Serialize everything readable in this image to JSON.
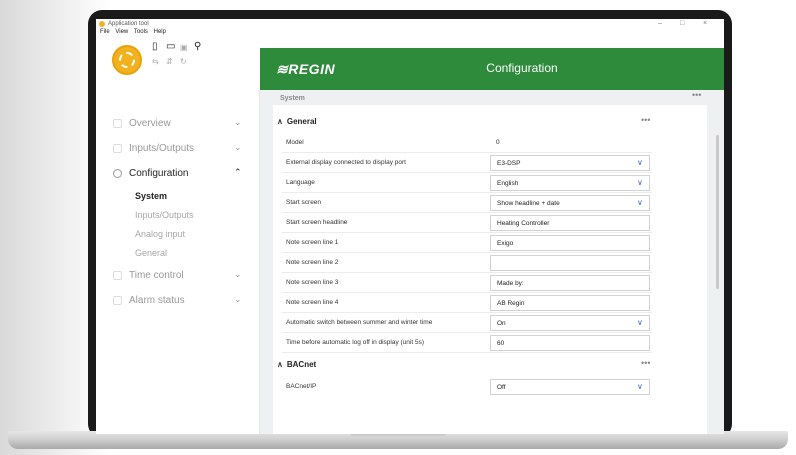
{
  "window": {
    "title": "Application tool",
    "controls": [
      "–",
      "□",
      "×"
    ]
  },
  "menu": [
    "File",
    "View",
    "Tools",
    "Help"
  ],
  "brand": {
    "logo_text": "≋REGIN",
    "accent_color": "#2e8b3b"
  },
  "header": {
    "title": "Configuration"
  },
  "sidebar": {
    "items": [
      {
        "label": "Overview",
        "chevron": "⌄"
      },
      {
        "label": "Inputs/Outputs",
        "chevron": "⌄"
      },
      {
        "label": "Configuration",
        "chevron": "⌃"
      },
      {
        "label": "Time control",
        "chevron": "⌄"
      },
      {
        "label": "Alarm status",
        "chevron": "⌄"
      }
    ],
    "subitems": [
      "System",
      "Inputs/Outputs",
      "Analog input",
      "General"
    ]
  },
  "content": {
    "breadcrumb": "System",
    "more": "•••",
    "general": {
      "title": "General",
      "caret": "∧",
      "rows": [
        {
          "label": "Model",
          "value": "0"
        },
        {
          "label": "External display connected to display port",
          "value": "E3-DSP",
          "chevron": "∨"
        },
        {
          "label": "Language",
          "value": "English",
          "chevron": "∨"
        },
        {
          "label": "Start screen",
          "value": "Show headline + date",
          "chevron": "∨"
        },
        {
          "label": "Start screen headline",
          "value": "Heating Controller"
        },
        {
          "label": "Note screen line 1",
          "value": "Exigo"
        },
        {
          "label": "Note screen line 2",
          "value": ""
        },
        {
          "label": "Note screen line 3",
          "value": "Made by:"
        },
        {
          "label": "Note screen line 4",
          "value": "AB Regin"
        },
        {
          "label": "Automatic switch between summer and winter time",
          "value": "On",
          "chevron": "∨"
        },
        {
          "label": "Time before automatic log off in display (unit 5s)",
          "value": "60"
        }
      ]
    },
    "bacnet": {
      "title": "BACnet",
      "caret": "∧",
      "rows": [
        {
          "label": "BACnet/IP",
          "value": "Off",
          "chevron": "∨"
        }
      ]
    }
  }
}
